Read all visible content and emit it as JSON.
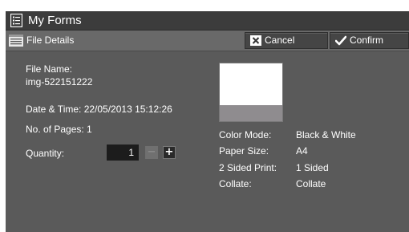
{
  "window": {
    "title": "My Forms",
    "title_icon": "document-list-icon"
  },
  "toolbar": {
    "section_title": "File Details",
    "section_icon": "file-details-icon",
    "cancel_label": "Cancel",
    "cancel_icon": "close-icon",
    "confirm_label": "Confirm",
    "confirm_icon": "checkmark-icon"
  },
  "details": {
    "file_name_label": "File Name:",
    "file_name_value": "img-522151222",
    "date_time_text": "Date & Time: 22/05/2013 15:12:26",
    "pages_text": "No. of Pages: 1",
    "quantity_label": "Quantity:",
    "quantity_value": "1",
    "minus_symbol": "−",
    "plus_symbol": "+"
  },
  "print_settings": {
    "color_mode_label": "Color Mode:",
    "color_mode_value": "Black & White",
    "paper_size_label": "Paper Size:",
    "paper_size_value": "A4",
    "sided_label": "2 Sided Print:",
    "sided_value": "1 Sided",
    "collate_label": "Collate:",
    "collate_value": "Collate"
  },
  "colors": {
    "titlebar": "#3c3c3c",
    "subbar": "#696969",
    "panel": "#5a5a5a",
    "button": "#454545",
    "text": "#ffffff"
  }
}
